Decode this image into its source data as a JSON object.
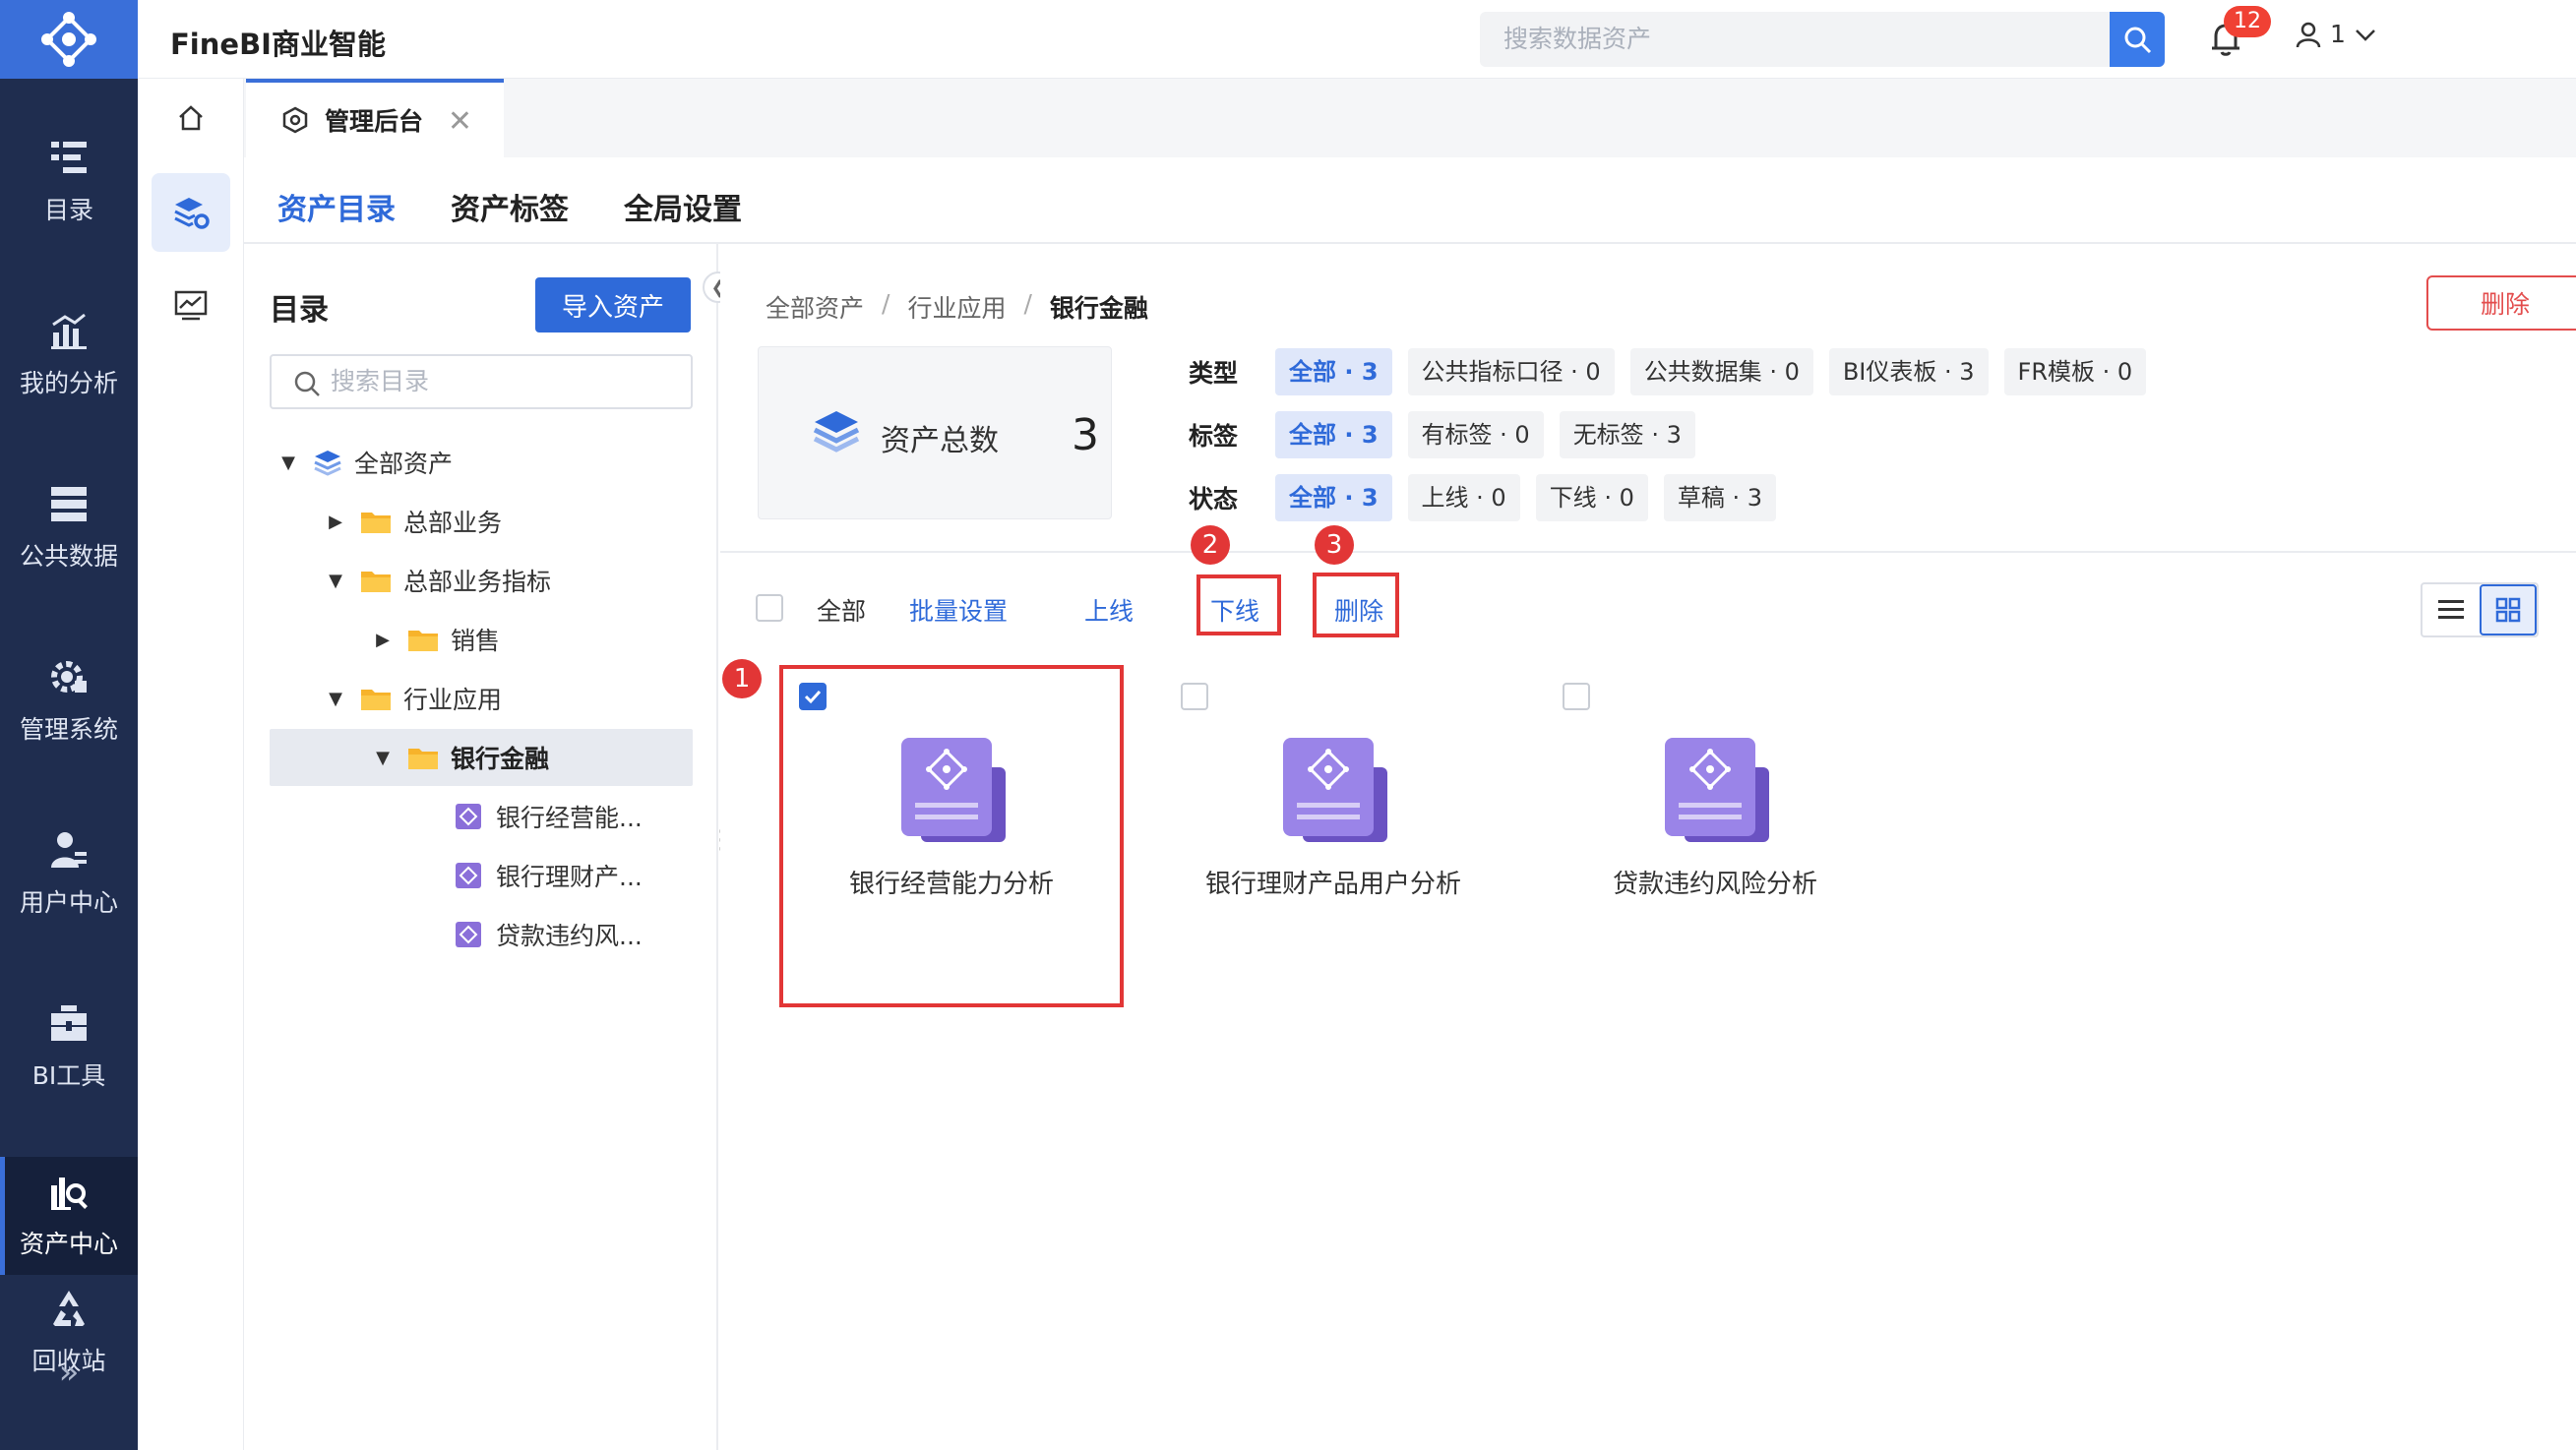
{
  "app": {
    "title": "FineBI商业智能"
  },
  "search": {
    "placeholder": "搜索数据资产"
  },
  "notifications": {
    "count": "12"
  },
  "user": {
    "name": "1"
  },
  "left_nav": [
    {
      "id": "catalog",
      "label": "目录",
      "icon": "list-icon"
    },
    {
      "id": "analysis",
      "label": "我的分析",
      "icon": "chart-icon"
    },
    {
      "id": "public-data",
      "label": "公共数据",
      "icon": "database-icon"
    },
    {
      "id": "admin",
      "label": "管理系统",
      "icon": "gear-icon"
    },
    {
      "id": "user-center",
      "label": "用户中心",
      "icon": "user-icon"
    },
    {
      "id": "bi-tools",
      "label": "BI工具",
      "icon": "toolbox-icon"
    },
    {
      "id": "asset-center",
      "label": "资产中心",
      "icon": "asset-search-icon",
      "active": true
    },
    {
      "id": "recycle",
      "label": "回收站",
      "icon": "recycle-icon"
    }
  ],
  "tabs": [
    {
      "label": "管理后台"
    }
  ],
  "subnav": [
    {
      "label": "资产目录",
      "active": true
    },
    {
      "label": "资产标签"
    },
    {
      "label": "全局设置"
    }
  ],
  "tree": {
    "title": "目录",
    "import_label": "导入资产",
    "search_placeholder": "搜索目录",
    "nodes": [
      {
        "label": "全部资产",
        "type": "layers",
        "depth": 0,
        "expanded": true
      },
      {
        "label": "总部业务",
        "type": "folder",
        "depth": 1,
        "expanded": false
      },
      {
        "label": "总部业务指标",
        "type": "folder",
        "depth": 1,
        "expanded": true
      },
      {
        "label": "销售",
        "type": "folder",
        "depth": 2,
        "expanded": false
      },
      {
        "label": "行业应用",
        "type": "folder",
        "depth": 1,
        "expanded": true
      },
      {
        "label": "银行金融",
        "type": "folder",
        "depth": 2,
        "expanded": true,
        "selected": true
      },
      {
        "label": "银行经营能...",
        "type": "report",
        "depth": 3
      },
      {
        "label": "银行理财产...",
        "type": "report",
        "depth": 3
      },
      {
        "label": "贷款违约风...",
        "type": "report",
        "depth": 3
      }
    ]
  },
  "breadcrumb": [
    "全部资产",
    "行业应用",
    "银行金融"
  ],
  "delete_label": "删除",
  "stats": {
    "label": "资产总数",
    "value": "3"
  },
  "filters": [
    {
      "key": "类型",
      "options": [
        "全部 · 3",
        "公共指标口径 · 0",
        "公共数据集 · 0",
        "BI仪表板 · 3",
        "FR模板 · 0"
      ]
    },
    {
      "key": "标签",
      "options": [
        "全部 · 3",
        "有标签 · 0",
        "无标签 · 3"
      ]
    },
    {
      "key": "状态",
      "options": [
        "全部 · 3",
        "上线 · 0",
        "下线 · 0",
        "草稿 · 3"
      ]
    }
  ],
  "toolbar": {
    "select_all": "全部",
    "batch": "批量设置",
    "online": "上线",
    "offline": "下线",
    "delete": "删除"
  },
  "annotations": [
    "1",
    "2",
    "3"
  ],
  "assets": [
    {
      "title": "银行经营能力分析",
      "checked": true
    },
    {
      "title": "银行理财产品用户分析",
      "checked": false
    },
    {
      "title": "贷款违约风险分析",
      "checked": false
    }
  ],
  "colors": {
    "primary": "#2f6ad9",
    "nav_bg": "#1f2d4f",
    "danger": "#e23636"
  }
}
